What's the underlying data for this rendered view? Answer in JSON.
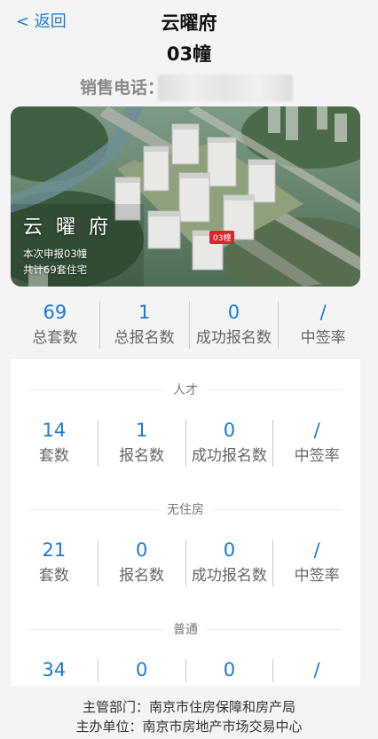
{
  "nav": {
    "back_label": "< 返回"
  },
  "header": {
    "project": "云曜府",
    "building": "03幢",
    "phone_label": "销售电话："
  },
  "hero": {
    "name": "云 曜 府",
    "line1": "本次申报03幢",
    "line2": "共计69套住宅",
    "tag": "03幢"
  },
  "summary": {
    "total_units": "69",
    "total_units_label": "总套数",
    "total_applicants": "1",
    "total_applicants_label": "总报名数",
    "success": "0",
    "success_label": "成功报名数",
    "rate": "/",
    "rate_label": "中签率"
  },
  "categories": [
    {
      "name": "人才",
      "units": "14",
      "units_label": "套数",
      "applicants": "1",
      "applicants_label": "报名数",
      "success": "0",
      "success_label": "成功报名数",
      "rate": "/",
      "rate_label": "中签率"
    },
    {
      "name": "无住房",
      "units": "21",
      "units_label": "套数",
      "applicants": "0",
      "applicants_label": "报名数",
      "success": "0",
      "success_label": "成功报名数",
      "rate": "/",
      "rate_label": "中签率"
    },
    {
      "name": "普通",
      "units": "34",
      "applicants": "0",
      "success": "0",
      "rate": "/"
    }
  ],
  "footer": {
    "dept": "主管部门：南京市住房保障和房产局",
    "organizer": "主办单位：南京市房地产市场交易中心"
  }
}
